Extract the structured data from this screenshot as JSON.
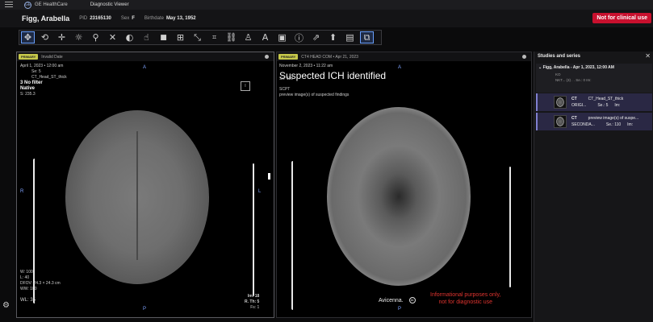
{
  "app": {
    "brand": "GE HealthCare",
    "title": "Diagnostic Viewer"
  },
  "patient": {
    "name": "Figg, Arabella",
    "pid_label": "PID",
    "pid": "23165130",
    "sex_label": "Sex",
    "sex": "F",
    "birth_label": "Birthdate",
    "birthdate": "May 13, 1952",
    "warning": "Not for clinical use"
  },
  "toolbar": {
    "tools": [
      "move-icon",
      "rotate-icon",
      "pan-icon",
      "brightness-icon",
      "zoom-icon",
      "crosshair-icon",
      "window-level-icon",
      "hand-pointer-icon",
      "invert-icon",
      "annotate-icon",
      "measure-icon",
      "link-icon",
      "person-icon",
      "text-icon",
      "save-icon",
      "info-icon",
      "export-icon",
      "key-image-icon",
      "report-icon",
      "layout-icon"
    ]
  },
  "viewport_left": {
    "badge": "PRIMARY",
    "header": "Invalid Date",
    "date": "April 1, 2023 • 12:00 am",
    "se": "Se: 5",
    "series_name": "CT_Head_ST_thick",
    "filter": "3 No filter",
    "mode": "Native",
    "s": "S: 235.3",
    "orient_top": "A",
    "orient_left": "R",
    "orient_right": "L",
    "orient_bottom": "P",
    "box_label": "I",
    "bl1": "W: 100",
    "bl2": "L: 40",
    "bl3": "DFOV: 24.3 × 24.3 cm",
    "bl4": "WW: 100",
    "bl5": "WL: 35",
    "br1": "Im: 18",
    "br2": "R. Th: 5",
    "br3": "Fs: 1"
  },
  "viewport_right": {
    "badge": "PRIMARY",
    "header": "CT4 HEAD COM • Apr 21, 2023",
    "date": "November 2, 2023 • 11:22 am",
    "se": "Se: 110",
    "sc": "SCPT",
    "desc": "preview image(s) of suspected findings",
    "ai_flag": "Suspected ICH identified",
    "orient_top": "A",
    "orient_bottom": "P",
    "vendor": "Avicenna.",
    "vendor_mark": "AI",
    "disclaimer_line1": "Informational purposes only,",
    "disclaimer_line2": "not for diagnostic use"
  },
  "panel": {
    "title": "Studies and series",
    "study_head": "Figg, Arabella  - Apr 1, 2023, 12:00 AM",
    "study_line1": "KO",
    "study_line2": "NKT... (3) . .   Se.: 0    Im: ",
    "series": [
      {
        "mod": "CT",
        "name": "CT_Head_ST_thick",
        "sub": "ORIGI...",
        "se": "Se.: 5",
        "im": "Im: "
      },
      {
        "mod": "CT",
        "name": "preview image(s) of suspe...",
        "sub": "SECONDA...",
        "se": "Se.: 110",
        "im": "Im: "
      }
    ]
  }
}
